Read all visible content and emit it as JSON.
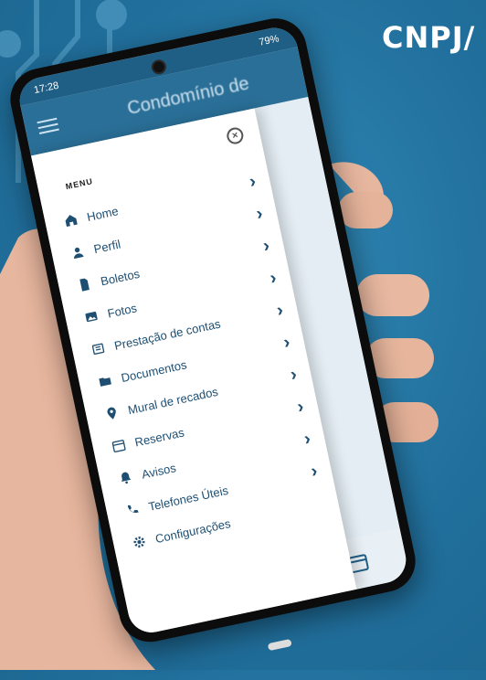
{
  "overlay": {
    "cnpj": "CNPJ/"
  },
  "status_bar": {
    "time": "17:28",
    "battery": "79%"
  },
  "app_bar": {
    "title": "Condomínio de"
  },
  "drawer": {
    "section_label": "MENU",
    "items": [
      {
        "label": "Home",
        "icon": "home-icon"
      },
      {
        "label": "Perfil",
        "icon": "person-icon"
      },
      {
        "label": "Boletos",
        "icon": "document-icon"
      },
      {
        "label": "Fotos",
        "icon": "image-icon"
      },
      {
        "label": "Prestação de contas",
        "icon": "receipt-icon"
      },
      {
        "label": "Documentos",
        "icon": "folder-icon"
      },
      {
        "label": "Mural de recados",
        "icon": "location-pin-icon"
      },
      {
        "label": "Reservas",
        "icon": "calendar-icon"
      },
      {
        "label": "Avisos",
        "icon": "bell-icon"
      },
      {
        "label": "Telefones Úteis",
        "icon": "phone-icon"
      },
      {
        "label": "Configurações",
        "icon": "gear-icon"
      }
    ]
  },
  "colors": {
    "background": "#216f9c",
    "app_bar": "#2a6f97",
    "accent_text": "#1e4f73",
    "home_active": "#e0a62a"
  }
}
